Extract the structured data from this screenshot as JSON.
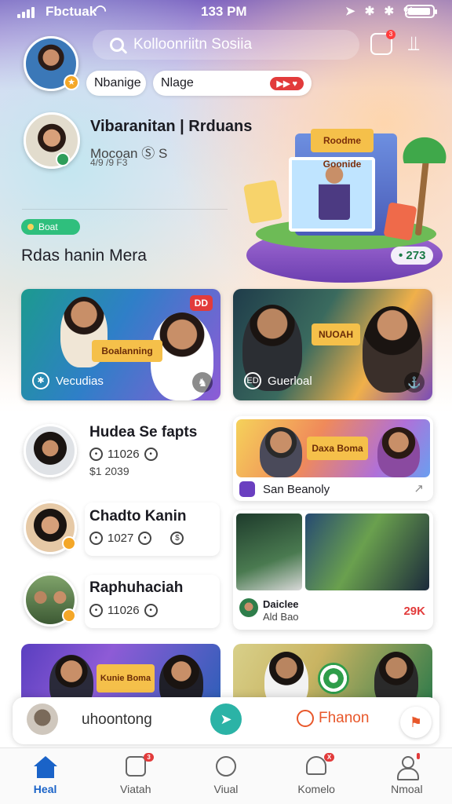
{
  "status_bar": {
    "carrier": "Fbctuak",
    "time": "133 PM",
    "icons": "➤ ✱ ✱ %"
  },
  "header": {
    "search_placeholder": "Kolloonriitn Sosiia",
    "notification_count": "3"
  },
  "pills": [
    {
      "label": "Nbanige"
    },
    {
      "label": "Nlage",
      "badge": "▶▶ ♥"
    }
  ],
  "profile": {
    "name": "Vibaranitan | Rrduans",
    "subtitle": "Mocoan",
    "subtitle_icons": "Ⓢ S",
    "date": "4/9 /9 F3"
  },
  "hero": {
    "sign": "Roodme Goonide",
    "count": "• 273"
  },
  "tag": {
    "label": "Boat"
  },
  "section_title": "Rdas hanin Mera",
  "feature_cards": [
    {
      "label": "Vecudias",
      "icon": "✱",
      "badge": "DD",
      "sign": "Boalanning",
      "corner": "♞"
    },
    {
      "label": "Guerloal",
      "icon": "ED",
      "sign": "NUOAH",
      "corner": "⚓"
    }
  ],
  "list_items": [
    {
      "name": "Hudea Se fapts",
      "meta": "11026",
      "sub": "$1 2039"
    },
    {
      "name": "Chadto Kanin",
      "meta": "1027",
      "sub": ""
    },
    {
      "name": "Raphuhaciah",
      "meta": "11026",
      "sub": ""
    }
  ],
  "right_cards": {
    "card1": {
      "sign": "Daxa Boma",
      "label": "San Beanoly",
      "share": "↗"
    },
    "card2": {
      "title": "Daiclee",
      "subtitle": "Ald Bao",
      "count": "29K"
    }
  },
  "bottom_cards": [
    {
      "sign": "Kunie Boma"
    },
    {
      "sign": ""
    }
  ],
  "player": {
    "title": "uhoontong",
    "right_label": "Fhanon",
    "play_icon": "➤",
    "fav_icon": "⚑"
  },
  "tabs": [
    {
      "label": "Heal",
      "active": true
    },
    {
      "label": "Viatah",
      "badge": "3"
    },
    {
      "label": "Viual"
    },
    {
      "label": "Komelo",
      "badge": "X"
    },
    {
      "label": "Nmoal",
      "badge": ""
    }
  ]
}
